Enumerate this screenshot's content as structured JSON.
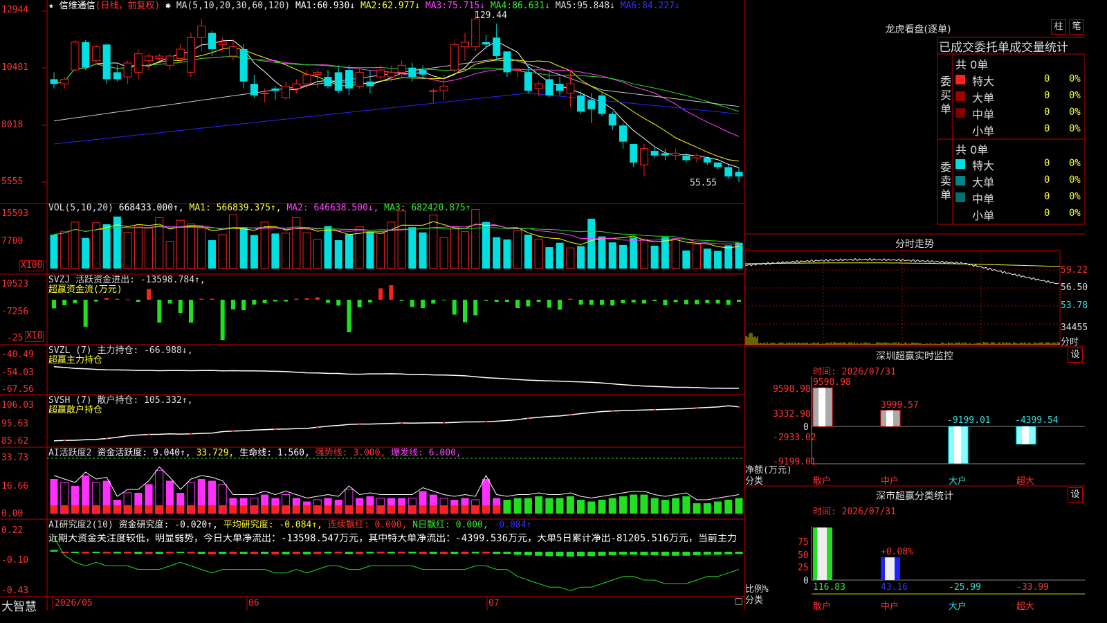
{
  "colors": {
    "up": "#ff2020",
    "down": "#00e0e0",
    "grid": "#c00000",
    "ma1": "#ffffff",
    "ma2": "#ffff00",
    "ma3": "#ff40ff",
    "ma4": "#20e020",
    "ma5": "#c8c8c8",
    "ma6": "#2828ff",
    "green": "#20e020",
    "magenta": "#ff30ff"
  },
  "header": {
    "title": "信维通信",
    "mode": "(日线，前复权)",
    "ma_spec": "MA(5,10,20,30,60,120)",
    "ma": [
      {
        "k": "MA1:",
        "v": "60.930↓"
      },
      {
        "k": "MA2:",
        "v": "62.977↓"
      },
      {
        "k": "MA3:",
        "v": "75.715↓"
      },
      {
        "k": "MA4:",
        "v": "86.631↓"
      },
      {
        "k": "MA5:",
        "v": "95.848↓"
      },
      {
        "k": "MA6:",
        "v": "84.227↓"
      }
    ],
    "max_label": "129.44",
    "min_label": "55.55"
  },
  "price_axis": [
    "12944",
    "10481",
    "8018",
    "5555"
  ],
  "vol": {
    "header": "VOL(5,10,20)",
    "value": "668433.000↑",
    "ma1": "MA1: 566839.375↑",
    "ma2": "MA2: 646638.500↓",
    "ma3": "MA3: 682420.875↑",
    "axis": [
      "15593",
      "7700"
    ],
    "unit": "X100"
  },
  "svzj": {
    "header": "SVZJ  活跃资金进出: -13598.784↑,",
    "sub": "超赢资金流(万元)",
    "axis": [
      "10523",
      "-7256",
      "-25"
    ],
    "unit": "X10"
  },
  "svzl": {
    "header": "SVZL (7) 主力持仓: -66.988↓,",
    "sub": "超赢主力持仓",
    "axis": [
      "-40.49",
      "-54.03",
      "-67.56"
    ]
  },
  "svsh": {
    "header": "SVSH (7) 散户持仓: 105.332↑,",
    "sub": "超赢散户持仓",
    "axis": [
      "106.03",
      "95.63",
      "85.62"
    ]
  },
  "ai1": {
    "name": "AI活跃度2",
    "k1": "资金活跃度: 9.040↑,",
    "k2": "33.729,",
    "k3": "生命线: 1.560,",
    "k4": "强势线: 3.000,",
    "k5": "爆发线: 6.000,",
    "axis": [
      "33.73",
      "16.66",
      "0.00"
    ]
  },
  "ai2": {
    "name": "AI研究度2(10)",
    "k1": "资金研究度: -0.020↑,",
    "k2": "平均研究度: -0.084↑,",
    "k3": "连续飘红: 0.000,",
    "k4": "N日飘红: 0.000,",
    "k5": "-0.084↑",
    "text": "近期大资金关注度较低，明显弱势，今日大单净流出：-13598.547万元，其中特大单净流出：-4399.536万元，大单5日累计净出-81205.516万元，当前主力",
    "axis": [
      "0.22",
      "-0.10",
      "-0.43"
    ]
  },
  "footer": {
    "brand": "大智慧",
    "d1": "2026/05",
    "d2": "06",
    "d3": "07"
  },
  "right": {
    "lh_title": "龙虎看盘(逐单)",
    "btn1": "柱",
    "btn2": "笔",
    "table_title": "已成交委托单成交量统计",
    "buy_side": "委买单",
    "sell_side": "委卖单",
    "total": "共 0单",
    "rows": [
      {
        "name": "特大",
        "n": "0",
        "p": "0%"
      },
      {
        "name": "大单",
        "n": "0",
        "p": "0%"
      },
      {
        "name": "中单",
        "n": "0",
        "p": "0%"
      },
      {
        "name": "小单",
        "n": "0",
        "p": "0%"
      }
    ],
    "fs_title": "分时走势",
    "fs_axis": [
      "59.22",
      "56.50",
      "53.78",
      "34455"
    ],
    "fs_unit": "分时",
    "sz_title": "深圳超赢实时监控",
    "sz_btn": "设",
    "sz_time": "时间: 2026/07/31",
    "sz_axis": [
      "9598.98",
      "3332.98",
      "0",
      "-2933.02",
      "-9199.01"
    ],
    "sz_vals": [
      "9598.98",
      "3999.57",
      "-9199.01",
      "-4399.54"
    ],
    "sz_ylabel": "净额(万元)",
    "sz_xlabel": "分类",
    "cats": [
      "散户",
      "中户",
      "大户",
      "超大"
    ],
    "ss_title": "深市超赢分类统计",
    "ss_btn": "设",
    "ss_time": "时间: 2026/07/31",
    "ss_axis": [
      "75",
      "50",
      "25",
      "0"
    ],
    "ss_vals": [
      "116.83",
      "43.16",
      "-25.99",
      "-33.99"
    ],
    "ss_ann": "+0.08%",
    "ss_ylabel": "比例%",
    "ss_xlabel": "分类"
  },
  "chart_data": [
    {
      "type": "candlestick",
      "name": "信维通信 日线",
      "ohlc": [
        [
          100,
          103,
          96,
          98
        ],
        [
          98,
          101,
          96,
          100
        ],
        [
          104,
          117,
          103,
          116
        ],
        [
          116,
          117,
          104,
          105
        ],
        [
          108,
          115,
          106,
          114
        ],
        [
          115,
          115,
          98,
          100
        ],
        [
          103,
          106,
          99,
          100
        ],
        [
          101,
          108,
          98,
          107
        ],
        [
          103,
          113,
          100,
          111
        ],
        [
          108,
          111,
          104,
          110
        ],
        [
          109,
          111,
          108,
          110
        ],
        [
          106,
          111,
          104,
          110
        ],
        [
          109,
          115,
          107,
          113
        ],
        [
          103,
          120,
          101,
          118
        ],
        [
          118,
          126,
          112,
          123
        ],
        [
          120,
          121,
          110,
          113
        ],
        [
          115,
          118,
          112,
          116
        ],
        [
          110,
          117,
          108,
          114
        ],
        [
          113,
          115,
          96,
          99
        ],
        [
          98,
          102,
          92,
          93
        ],
        [
          94,
          96,
          90,
          94
        ],
        [
          96,
          97,
          91,
          95
        ],
        [
          92,
          99,
          91,
          97
        ],
        [
          96,
          100,
          94,
          98
        ],
        [
          98,
          104,
          96,
          102
        ],
        [
          102,
          104,
          96,
          103
        ],
        [
          101,
          104,
          96,
          97
        ],
        [
          103,
          106,
          94,
          95
        ],
        [
          104,
          106,
          93,
          96
        ],
        [
          97,
          105,
          96,
          103
        ],
        [
          99,
          104,
          94,
          97
        ],
        [
          101,
          106,
          100,
          104
        ],
        [
          101,
          106,
          99,
          103
        ],
        [
          103,
          108,
          101,
          106
        ],
        [
          105,
          107,
          99,
          101
        ],
        [
          104,
          106,
          100,
          102
        ],
        [
          95,
          96,
          90,
          95
        ],
        [
          95,
          102,
          91,
          97
        ],
        [
          104,
          116,
          103,
          115
        ],
        [
          114,
          120,
          108,
          116
        ],
        [
          114,
          129.44,
          112,
          126
        ],
        [
          116,
          119,
          113,
          115
        ],
        [
          118,
          124,
          108,
          110
        ],
        [
          112,
          108,
          101,
          103
        ],
        [
          104,
          104,
          101,
          104
        ],
        [
          103,
          106,
          94,
          95
        ],
        [
          96,
          99,
          93,
          98
        ],
        [
          100,
          103,
          92,
          93
        ],
        [
          98,
          101,
          93,
          95
        ],
        [
          94,
          104,
          88,
          98
        ],
        [
          93,
          95,
          85,
          86
        ],
        [
          91,
          94,
          81,
          87
        ],
        [
          93,
          94,
          84,
          85
        ],
        [
          85,
          86,
          78,
          80
        ],
        [
          80,
          81,
          70,
          73
        ],
        [
          72,
          72,
          62,
          64
        ],
        [
          63,
          72,
          58,
          70
        ],
        [
          69,
          71,
          66,
          67
        ],
        [
          68,
          70,
          65,
          67
        ],
        [
          67,
          70,
          65,
          68
        ],
        [
          67,
          68,
          64,
          65
        ],
        [
          66,
          68,
          64,
          67
        ],
        [
          66,
          66,
          63,
          64
        ],
        [
          64,
          64,
          61,
          62
        ],
        [
          62,
          63,
          57,
          58
        ],
        [
          60,
          62,
          55.55,
          58
        ]
      ],
      "ma_series": [
        "MA1",
        "MA2",
        "MA3",
        "MA4",
        "MA5",
        "MA6"
      ]
    },
    {
      "type": "bar",
      "name": "VOL",
      "values": [
        9.2,
        10.1,
        12.6,
        8.3,
        12.4,
        12.0,
        14.1,
        9.8,
        11.5,
        10.9,
        13.8,
        7.4,
        13.1,
        12.1,
        11.0,
        7.7,
        9.2,
        14.6,
        11.2,
        9.1,
        12.6,
        9.5,
        9.6,
        13.8,
        9.7,
        7.9,
        11.5,
        7.7,
        9.3,
        11.3,
        9.8,
        9.5,
        12.6,
        15.6,
        11.2,
        9.8,
        14.5,
        8.4,
        11.3,
        10.0,
        16.0,
        12.6,
        8.5,
        7.9,
        10.4,
        9.2,
        8.0,
        5.8,
        7.0,
        5.6,
        6.1,
        13.5,
        8.7,
        7.1,
        6.4,
        8.4,
        8.0,
        6.2,
        8.5,
        8.1,
        4.9,
        6.6,
        5.4,
        4.8,
        6.3,
        7.0
      ]
    },
    {
      "type": "bar",
      "name": "SVZJ",
      "values": [
        -2.5,
        -1.6,
        -1,
        -7.8,
        -0.5,
        0.5,
        0.3,
        0.1,
        -0.6,
        3.1,
        -6.6,
        -1.1,
        -3.8,
        -6.6,
        0.3,
        0.3,
        -11.6,
        -2.8,
        -3,
        -1.4,
        -1,
        -0.5,
        -0.5,
        0.3,
        0.4,
        0.7,
        -0.9,
        -1.7,
        -9.4,
        -2.2,
        -0.8,
        3.3,
        4.2,
        -0.3,
        -2.1,
        -2.4,
        -1.1,
        -0.2,
        -4.3,
        -6.5,
        -4.5,
        -0.3,
        -0.6,
        -0.6,
        -2.4,
        -1.9,
        -0.6,
        -2.3,
        -2.9,
        0.3,
        -1.4,
        -1.5,
        -1.5,
        -1.7,
        -1,
        -0.8,
        -1.1,
        -0.4,
        -1.6,
        -0.7,
        -1.3,
        -1.3,
        -1,
        -1.1,
        -1.5,
        -0.6
      ]
    },
    {
      "type": "line",
      "name": "SVZL",
      "values": [
        -50.1,
        -50.6,
        -51.4,
        -51.7,
        -52.2,
        -52.5,
        -52.6,
        -52.7,
        -53.0,
        -53.0,
        -53.2,
        -53.1,
        -53.1,
        -53.2,
        -53.1,
        -53.0,
        -53.4,
        -53.2,
        -53.3,
        -53.4,
        -53.5,
        -53.7,
        -53.9,
        -54.4,
        -54.9,
        -55.0,
        -55.3,
        -55.4,
        -55.9,
        -56.0,
        -55.7,
        -55.7,
        -55.6,
        -55.8,
        -56.3,
        -56.2,
        -56.5,
        -56.6,
        -56.9,
        -57.2,
        -57.9,
        -58.7,
        -59.1,
        -59.6,
        -60.1,
        -60.6,
        -60.9,
        -61.2,
        -61.4,
        -61.7,
        -62.0,
        -62.3,
        -62.8,
        -63.5,
        -64.2,
        -64.7,
        -65.3,
        -65.5,
        -65.9,
        -66.2,
        -66.2,
        -66.4,
        -66.8,
        -66.9,
        -67.0,
        -66.99
      ]
    },
    {
      "type": "line",
      "name": "SVSH",
      "values": [
        86.1,
        86.3,
        86.4,
        86.7,
        86.9,
        87.4,
        88.1,
        88.9,
        89.4,
        89.7,
        89.8,
        90.0,
        89.9,
        90.0,
        90.3,
        90.5,
        91.3,
        91.6,
        91.8,
        92.2,
        92.4,
        92.7,
        92.8,
        93.0,
        93.1,
        93.8,
        94.4,
        94.8,
        95.4,
        95.6,
        95.6,
        95.8,
        96.0,
        96.2,
        96.1,
        96.2,
        96.3,
        96.3,
        96.5,
        96.8,
        96.8,
        96.9,
        97.2,
        97.6,
        98.1,
        98.9,
        99.4,
        99.9,
        100.2,
        100.8,
        101.5,
        102.1,
        102.7,
        103.0,
        103.2,
        103.4,
        103.6,
        103.7,
        103.9,
        104.1,
        104.3,
        104.7,
        105.0,
        105.3,
        105.9,
        105.33
      ]
    },
    {
      "type": "bar",
      "name": "AI活跃度2",
      "values": [
        20,
        18,
        16,
        22,
        18,
        19,
        8,
        12,
        12,
        17,
        25,
        19,
        12,
        18,
        20,
        19,
        17,
        9,
        9,
        9,
        11,
        9,
        11,
        9,
        7,
        8,
        9,
        8,
        14,
        9,
        10,
        9,
        9,
        9,
        9,
        13,
        11,
        9,
        8,
        9,
        8,
        20,
        9,
        8,
        9,
        9,
        10,
        9,
        9,
        10,
        8,
        7,
        8,
        9,
        10,
        11,
        11,
        9,
        8,
        9,
        10,
        6,
        6,
        7,
        8,
        9
      ],
      "magenta_idx": [
        0,
        1,
        2,
        3,
        4,
        5,
        6,
        7,
        8,
        9,
        10,
        11,
        12,
        13,
        14,
        15,
        16,
        17,
        18,
        19,
        20,
        21,
        22,
        23,
        24,
        25,
        26,
        27,
        28,
        29,
        30,
        31,
        32,
        33,
        34,
        35,
        36,
        37,
        38,
        39,
        40,
        41,
        42
      ]
    },
    {
      "type": "bar",
      "name": "AI研究度2(10)",
      "values": [
        0.04,
        -0.01,
        -0.03,
        -0.04,
        -0.03,
        -0.04,
        -0.04,
        -0.04,
        -0.05,
        -0.05,
        -0.05,
        -0.04,
        -0.03,
        -0.04,
        -0.05,
        -0.06,
        -0.05,
        -0.05,
        -0.05,
        -0.05,
        -0.05,
        -0.06,
        -0.06,
        -0.05,
        -0.06,
        -0.05,
        -0.04,
        -0.04,
        -0.05,
        -0.05,
        -0.04,
        -0.04,
        -0.04,
        -0.04,
        -0.04,
        -0.05,
        -0.05,
        -0.05,
        -0.05,
        -0.05,
        -0.04,
        -0.04,
        -0.05,
        -0.05,
        -0.07,
        -0.08,
        -0.09,
        -0.1,
        -0.1,
        -0.11,
        -0.1,
        -0.1,
        -0.09,
        -0.08,
        -0.07,
        -0.07,
        -0.08,
        -0.08,
        -0.09,
        -0.09,
        -0.09,
        -0.08,
        -0.07,
        -0.07,
        -0.06,
        -0.05
      ]
    }
  ]
}
